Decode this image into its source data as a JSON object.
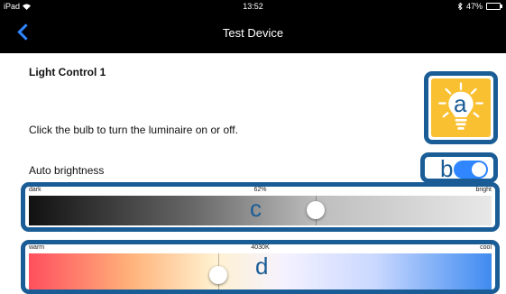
{
  "status_bar": {
    "device": "iPad",
    "time": "13:52",
    "battery": "47%"
  },
  "nav": {
    "title": "Test Device",
    "back_icon": "chevron-left-icon"
  },
  "section": {
    "title": "Light Control 1",
    "instruction": "Click the bulb to turn the luminaire on or off."
  },
  "bulb": {
    "icon": "lightbulb-icon",
    "state_color": "#f9c032",
    "callout": "a"
  },
  "auto_brightness": {
    "label": "Auto brightness",
    "enabled": true,
    "callout": "b"
  },
  "brightness_slider": {
    "min_label": "dark",
    "value_label": "62%",
    "max_label": "bright",
    "value_fraction": 0.62,
    "callout": "c"
  },
  "color_temp_slider": {
    "min_label": "warm",
    "value_label": "4030K",
    "max_label": "cool",
    "value_fraction": 0.41,
    "callout": "d"
  },
  "colors": {
    "accent": "#2f86ff",
    "callout_border": "#1a5d96",
    "bulb_background": "#f9c032"
  }
}
